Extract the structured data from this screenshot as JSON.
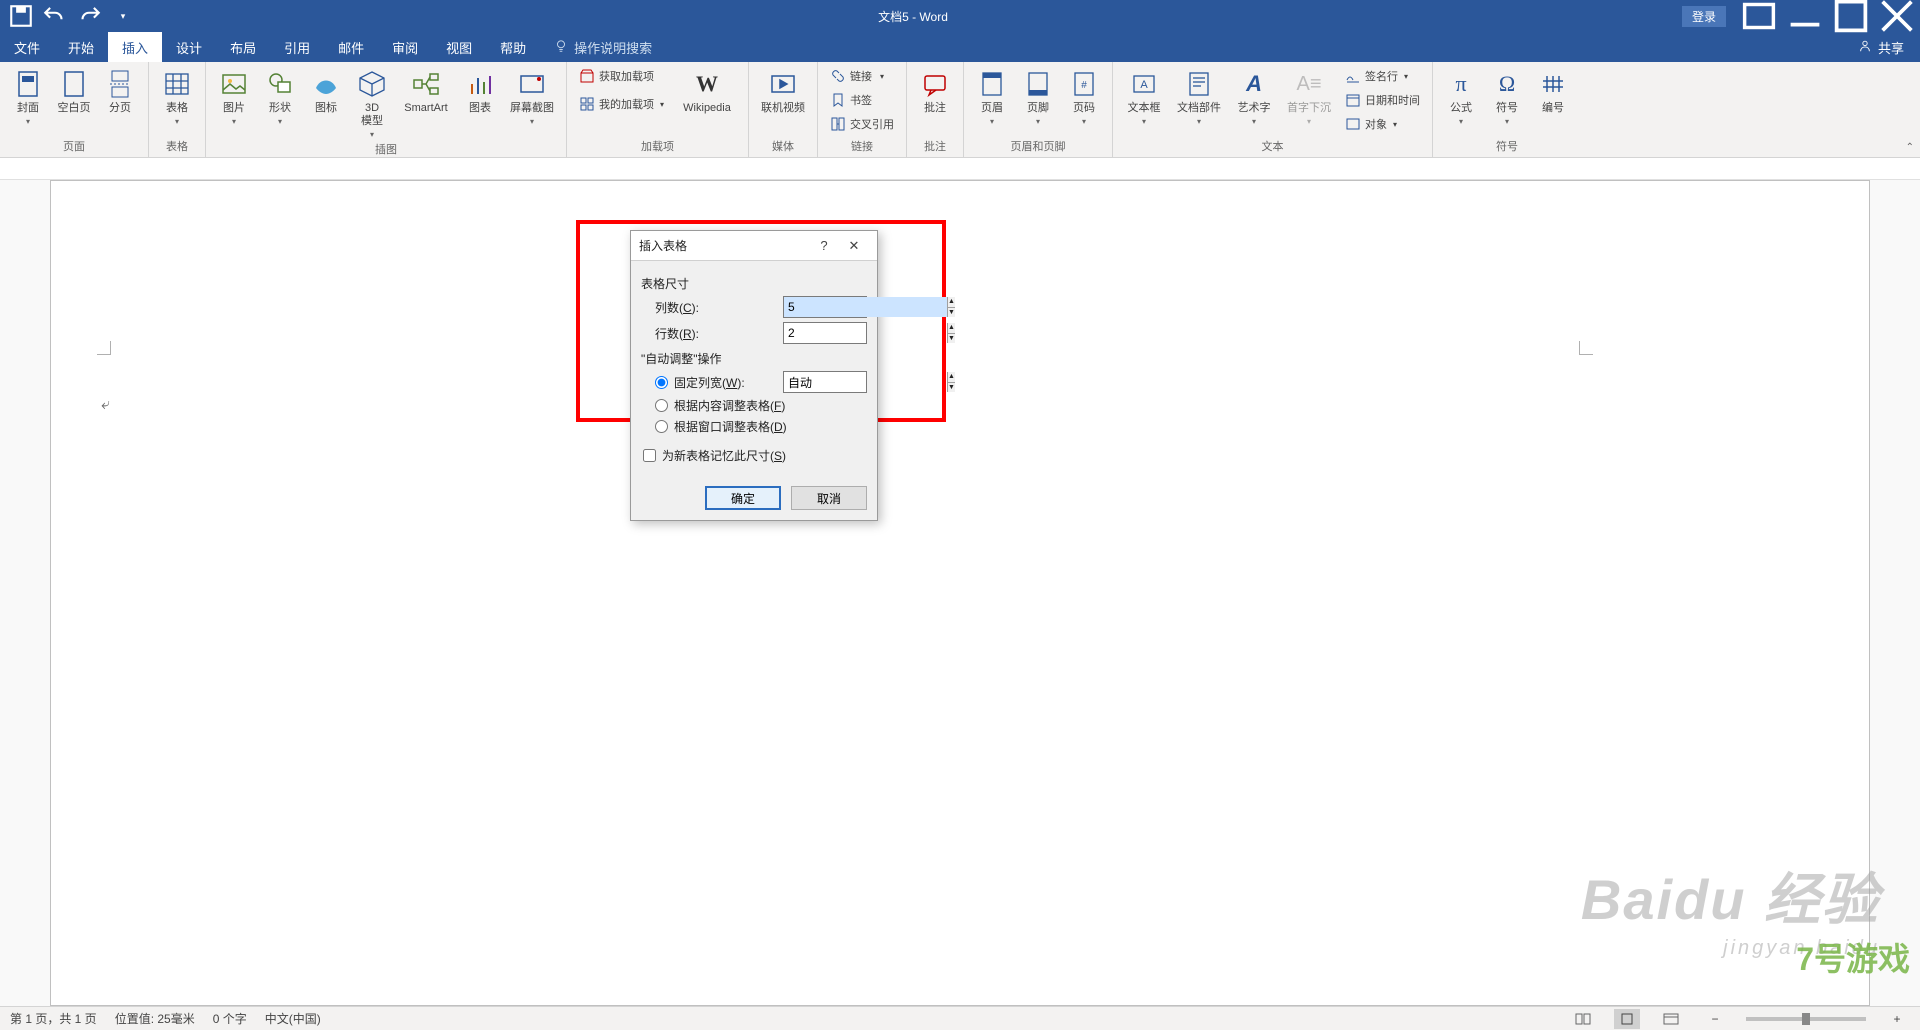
{
  "titlebar": {
    "title": "文档5 - Word",
    "login": "登录"
  },
  "tabs": {
    "file": "文件",
    "home": "开始",
    "insert": "插入",
    "design": "设计",
    "layout": "布局",
    "references": "引用",
    "mailings": "邮件",
    "review": "审阅",
    "view": "视图",
    "help": "帮助",
    "tell_me": "操作说明搜索",
    "share": "共享"
  },
  "ribbon": {
    "groups": {
      "pages": {
        "label": "页面",
        "cover": "封面",
        "blank": "空白页",
        "break": "分页"
      },
      "tables": {
        "label": "表格",
        "btn": "表格"
      },
      "illustrations": {
        "label": "插图",
        "pictures": "图片",
        "shapes": "形状",
        "icons": "图标",
        "model3d": "3D\n模型",
        "smartart": "SmartArt",
        "chart": "图表",
        "screenshot": "屏幕截图"
      },
      "addins": {
        "label": "加载项",
        "get": "获取加载项",
        "my": "我的加载项",
        "wiki": "Wikipedia"
      },
      "media": {
        "label": "媒体",
        "video": "联机视频"
      },
      "links": {
        "label": "链接",
        "link": "链接",
        "bookmark": "书签",
        "xref": "交叉引用"
      },
      "comments": {
        "label": "批注",
        "btn": "批注"
      },
      "headerfooter": {
        "label": "页眉和页脚",
        "header": "页眉",
        "footer": "页脚",
        "pagenum": "页码"
      },
      "text": {
        "label": "文本",
        "textbox": "文本框",
        "quickparts": "文档部件",
        "wordart": "艺术字",
        "dropcap": "首字下沉",
        "sigline": "签名行",
        "datetime": "日期和时间",
        "object": "对象"
      },
      "symbols": {
        "label": "符号",
        "equation": "公式",
        "symbol": "符号",
        "number": "编号"
      }
    }
  },
  "dialog": {
    "title": "插入表格",
    "section_size": "表格尺寸",
    "columns_label": "列数(C):",
    "columns_value": "5",
    "rows_label": "行数(R):",
    "rows_value": "2",
    "section_auto": "\"自动调整\"操作",
    "opt_fixed": "固定列宽(W):",
    "fixed_value": "自动",
    "opt_content": "根据内容调整表格(F)",
    "opt_window": "根据窗口调整表格(D)",
    "remember": "为新表格记忆此尺寸(S)",
    "ok": "确定",
    "cancel": "取消"
  },
  "statusbar": {
    "page": "第 1 页，共 1 页",
    "position": "位置值: 25毫米",
    "words": "0 个字",
    "lang": "中文(中国)"
  },
  "watermark": {
    "big": "Baidu 经验",
    "small": "jingyan.baidu",
    "stamp": "7号游戏"
  }
}
